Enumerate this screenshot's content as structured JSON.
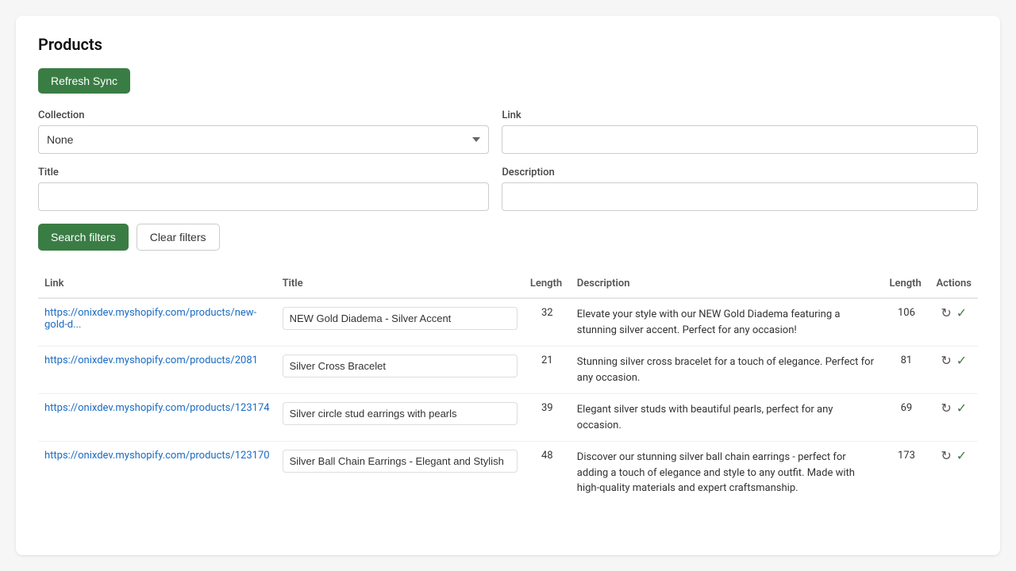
{
  "page": {
    "title": "Products",
    "refresh_btn": "Refresh Sync"
  },
  "filters": {
    "collection_label": "Collection",
    "collection_value": "None",
    "collection_options": [
      "None"
    ],
    "link_label": "Link",
    "link_value": "",
    "link_placeholder": "",
    "title_label": "Title",
    "title_value": "",
    "title_placeholder": "",
    "description_label": "Description",
    "description_value": "",
    "description_placeholder": ""
  },
  "buttons": {
    "search": "Search filters",
    "clear": "Clear filters"
  },
  "table": {
    "headers": {
      "link": "Link",
      "title": "Title",
      "length_title": "Length",
      "description": "Description",
      "length_desc": "Length",
      "actions": "Actions"
    },
    "rows": [
      {
        "link": "https://onixdev.myshopify.com/products/new-gold-d...",
        "link_full": "https://onixdev.myshopify.com/products/new-gold-d",
        "title": "NEW Gold Diadema - Silver Accent",
        "title_length": "32",
        "description": "Elevate your style with our NEW Gold Diadema featuring a stunning silver accent. Perfect for any occasion!",
        "desc_length": "106"
      },
      {
        "link": "https://onixdev.myshopify.com/products/2081",
        "link_full": "https://onixdev.myshopify.com/products/2081",
        "title": "Silver Cross Bracelet",
        "title_length": "21",
        "description": "Stunning silver cross bracelet for a touch of elegance. Perfect for any occasion.",
        "desc_length": "81"
      },
      {
        "link": "https://onixdev.myshopify.com/products/123174",
        "link_full": "https://onixdev.myshopify.com/products/123174",
        "title": "Silver circle stud earrings with pearls",
        "title_length": "39",
        "description": "Elegant silver studs with beautiful pearls, perfect for any occasion.",
        "desc_length": "69"
      },
      {
        "link": "https://onixdev.myshopify.com/products/123170",
        "link_full": "https://onixdev.myshopify.com/products/123170",
        "title": "Silver Ball Chain Earrings - Elegant and Stylish",
        "title_length": "48",
        "description": "Discover our stunning silver ball chain earrings - perfect for adding a touch of elegance and style to any outfit. Made with high-quality materials and expert craftsmanship.",
        "desc_length": "173"
      }
    ]
  }
}
